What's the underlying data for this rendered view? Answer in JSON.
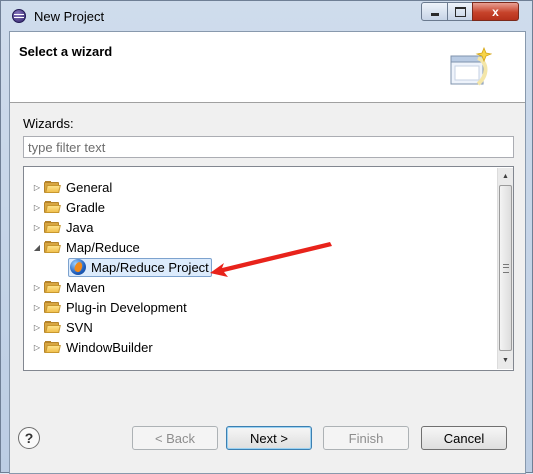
{
  "window": {
    "title": "New Project"
  },
  "banner": {
    "title": "Select a wizard"
  },
  "wizards_label": "Wizards:",
  "filter": {
    "value": "",
    "placeholder": "type filter text"
  },
  "tree": {
    "items": [
      {
        "label": "General",
        "expanded": false,
        "level": 0,
        "icon": "folder-icon"
      },
      {
        "label": "Gradle",
        "expanded": false,
        "level": 0,
        "icon": "folder-icon"
      },
      {
        "label": "Java",
        "expanded": false,
        "level": 0,
        "icon": "folder-icon"
      },
      {
        "label": "Map/Reduce",
        "expanded": true,
        "level": 0,
        "icon": "folder-open-icon"
      },
      {
        "label": "Map/Reduce Project",
        "selected": true,
        "level": 1,
        "icon": "mapreduce-project-icon"
      },
      {
        "label": "Maven",
        "expanded": false,
        "level": 0,
        "icon": "folder-icon"
      },
      {
        "label": "Plug-in Development",
        "expanded": false,
        "level": 0,
        "icon": "folder-icon"
      },
      {
        "label": "SVN",
        "expanded": false,
        "level": 0,
        "icon": "folder-icon"
      },
      {
        "label": "WindowBuilder",
        "expanded": false,
        "level": 0,
        "icon": "folder-icon"
      }
    ]
  },
  "buttons": {
    "help": "?",
    "back": "< Back",
    "next": "Next >",
    "finish": "Finish",
    "cancel": "Cancel"
  },
  "window_controls": {
    "close": "x"
  },
  "colors": {
    "selection": "#dcebfc",
    "annotation_arrow": "#e8231b"
  }
}
